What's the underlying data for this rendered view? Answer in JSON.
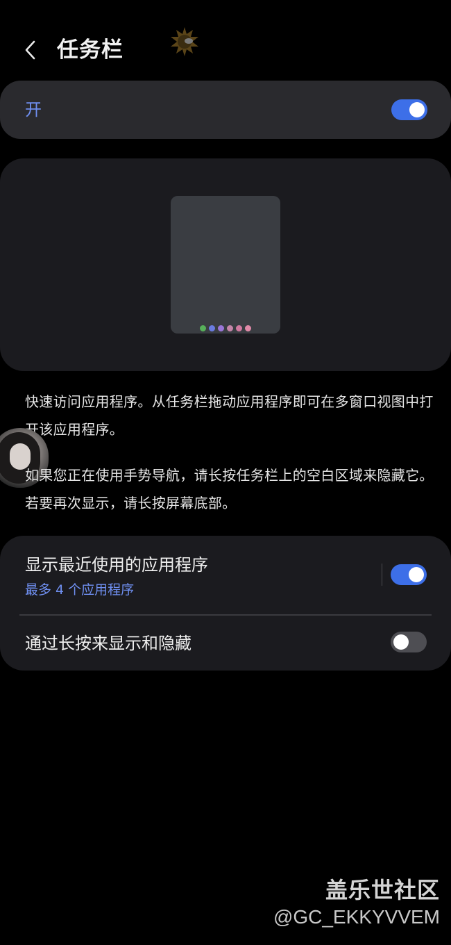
{
  "header": {
    "title": "任务栏",
    "back_icon": "chevron-left-icon"
  },
  "master_switch": {
    "label": "开",
    "state": "on"
  },
  "preview": {
    "dock_colors": [
      "#57b05a",
      "#6a7be0",
      "#9a76d8",
      "#c485a8",
      "#d07aa0",
      "#e08aa8"
    ]
  },
  "description": {
    "paragraph_1": "快速访问应用程序。从任务栏拖动应用程序即可在多窗口视图中打开该应用程序。",
    "paragraph_2": "如果您正在使用手势导航，请长按任务栏上的空白区域来隐藏它。若要再次显示，请长按屏幕底部。"
  },
  "settings": {
    "recent_apps": {
      "title": "显示最近使用的应用程序",
      "subtitle": "最多 4 个应用程序",
      "state": "on"
    },
    "long_press": {
      "title": "通过长按来显示和隐藏",
      "state": "off"
    }
  },
  "colors": {
    "accent": "#3d6fe8",
    "accent_text": "#6f8ff0",
    "card_bg": "#1b1b1f",
    "switch_card_bg": "#2a2a2e"
  },
  "watermark": {
    "site": "盖乐世社区",
    "handle": "@GC_EKKYVVEM"
  }
}
